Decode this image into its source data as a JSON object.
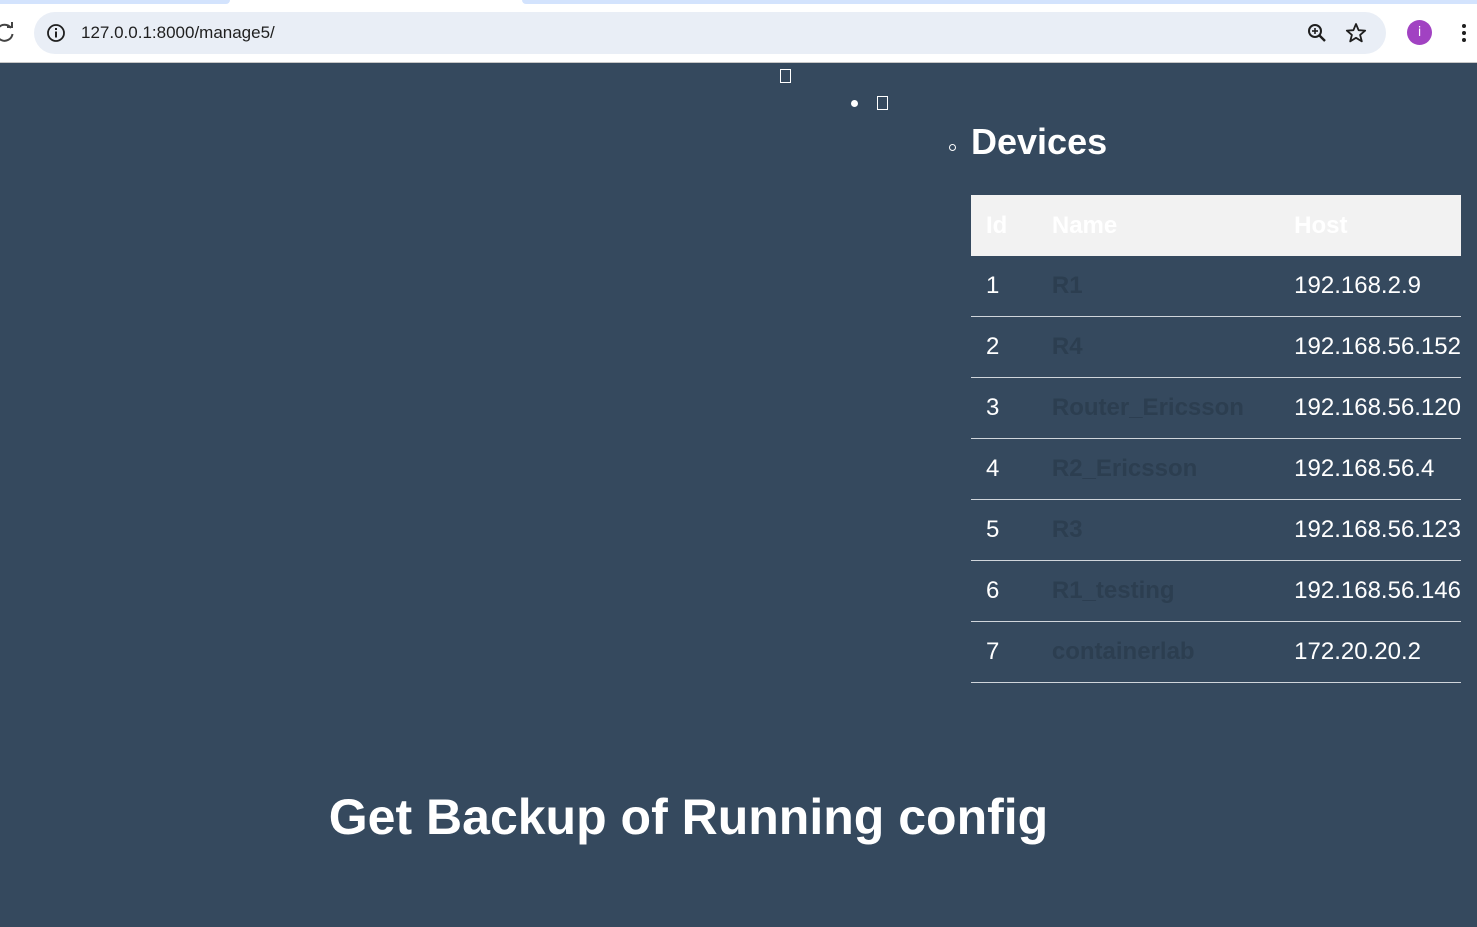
{
  "browser": {
    "url": "127.0.0.1:8000/manage5/",
    "avatar_initial": "i"
  },
  "page": {
    "background": "#35495e",
    "devices_title": "Devices",
    "table": {
      "columns": [
        "Id",
        "Name",
        "Host"
      ],
      "rows": [
        {
          "id": "1",
          "name": "R1",
          "host": "192.168.2.9"
        },
        {
          "id": "2",
          "name": "R4",
          "host": "192.168.56.152"
        },
        {
          "id": "3",
          "name": "Router_Ericsson",
          "host": "192.168.56.120"
        },
        {
          "id": "4",
          "name": "R2_Ericsson",
          "host": "192.168.56.4"
        },
        {
          "id": "5",
          "name": "R3",
          "host": "192.168.56.123"
        },
        {
          "id": "6",
          "name": "R1_testing",
          "host": "192.168.56.146"
        },
        {
          "id": "7",
          "name": "containerlab",
          "host": "172.20.20.2"
        }
      ]
    },
    "backup_title": "Get Backup of Running config"
  }
}
